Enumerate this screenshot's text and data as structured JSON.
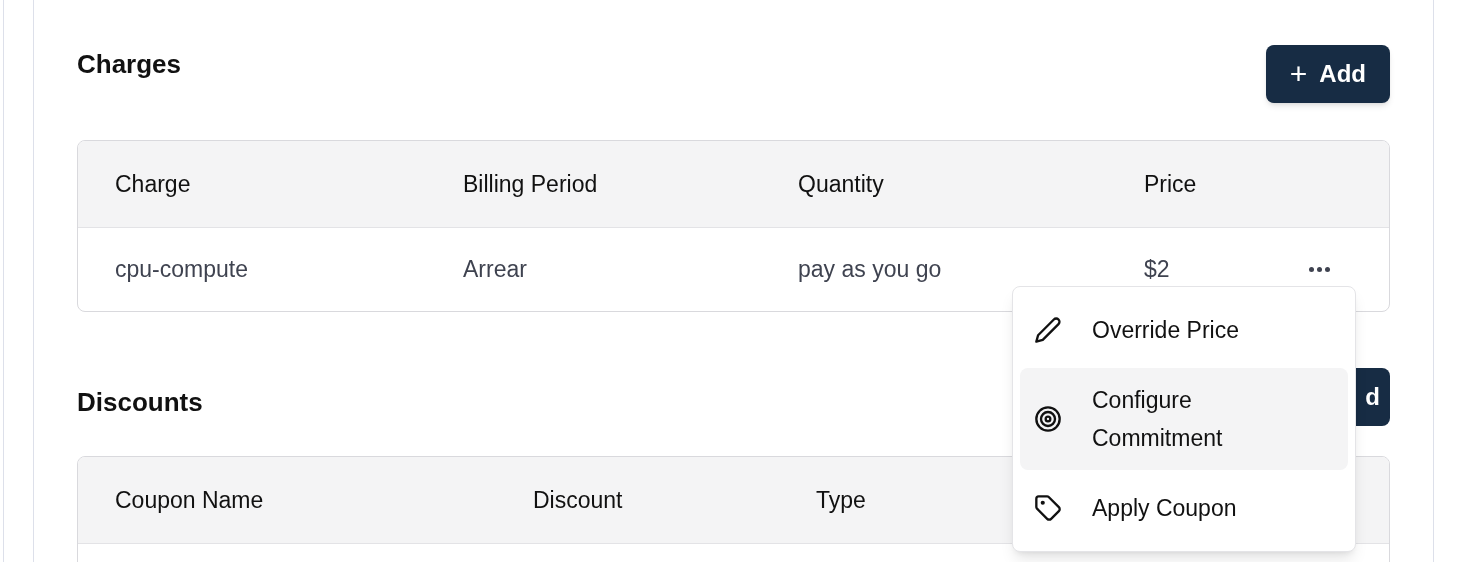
{
  "charges": {
    "title": "Charges",
    "add_button": {
      "icon": "+",
      "label": "Add"
    },
    "table": {
      "columns": [
        "Charge",
        "Billing Period",
        "Quantity",
        "Price"
      ],
      "rows": [
        {
          "cells": [
            "cpu-compute",
            "Arrear",
            "pay as you go",
            "$2"
          ]
        }
      ]
    }
  },
  "discounts": {
    "title": "Discounts",
    "add_button": {
      "label": "d"
    },
    "table": {
      "columns": [
        "Coupon Name",
        "Discount",
        "Type"
      ]
    }
  },
  "row_menu": {
    "items": [
      {
        "kind": "pencil",
        "label": "Override Price",
        "selected": false
      },
      {
        "kind": "target",
        "label": "Configure Commitment",
        "selected": true
      },
      {
        "kind": "tag",
        "label": "Apply Coupon",
        "selected": false
      }
    ]
  }
}
